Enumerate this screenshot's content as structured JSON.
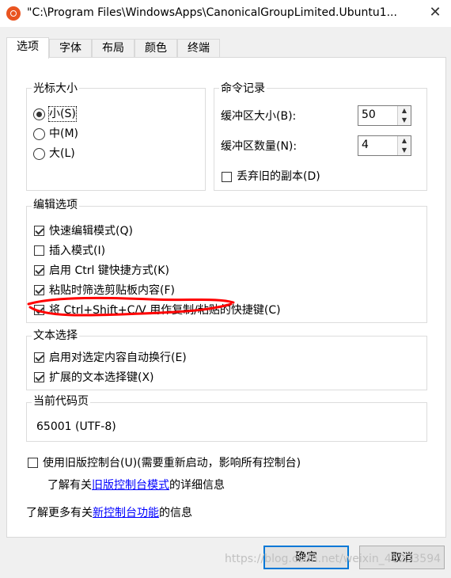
{
  "window": {
    "title": "\"C:\\Program Files\\WindowsApps\\CanonicalGroupLimited.Ubuntu1...",
    "close_glyph": "✕"
  },
  "tabs": [
    "选项",
    "字体",
    "布局",
    "颜色",
    "终端"
  ],
  "cursor_size": {
    "title": "光标大小",
    "options": [
      {
        "label": "小(S)",
        "selected": true
      },
      {
        "label": "中(M)",
        "selected": false
      },
      {
        "label": "大(L)",
        "selected": false
      }
    ]
  },
  "command_history": {
    "title": "命令记录",
    "buffer_size_label": "缓冲区大小(B):",
    "buffer_size_value": "50",
    "buffer_count_label": "缓冲区数量(N):",
    "buffer_count_value": "4",
    "discard_label": "丢弃旧的副本(D)",
    "discard_checked": false
  },
  "edit_options": {
    "title": "编辑选项",
    "items": [
      {
        "label": "快速编辑模式(Q)",
        "checked": true
      },
      {
        "label": "插入模式(I)",
        "checked": false
      },
      {
        "label": "启用 Ctrl 键快捷方式(K)",
        "checked": true
      },
      {
        "label": "粘贴时筛选剪贴板内容(F)",
        "checked": true
      },
      {
        "label": "将 Ctrl+Shift+C/V 用作复制/粘贴的快捷键(C)",
        "checked": true
      }
    ]
  },
  "text_selection": {
    "title": "文本选择",
    "items": [
      {
        "label": "启用对选定内容自动换行(E)",
        "checked": true
      },
      {
        "label": "扩展的文本选择键(X)",
        "checked": true
      }
    ]
  },
  "codepage": {
    "title": "当前代码页",
    "value": "65001 (UTF-8)"
  },
  "legacy": {
    "label": "使用旧版控制台(U)(需要重新启动，影响所有控制台)",
    "checked": false,
    "info_prefix": "了解有关",
    "info_link": "旧版控制台模式",
    "info_suffix": "的详细信息"
  },
  "more_info": {
    "prefix": "了解更多有关",
    "link": "新控制台功能",
    "suffix": "的信息"
  },
  "buttons": {
    "ok": "确定",
    "cancel": "取消"
  },
  "watermark": "https://blog.csdn.net/weixin_43233594",
  "colors": {
    "accent": "#0078d7",
    "link": "#0000ff",
    "annotation": "#ff0000",
    "ubuntu": "#e95420"
  }
}
